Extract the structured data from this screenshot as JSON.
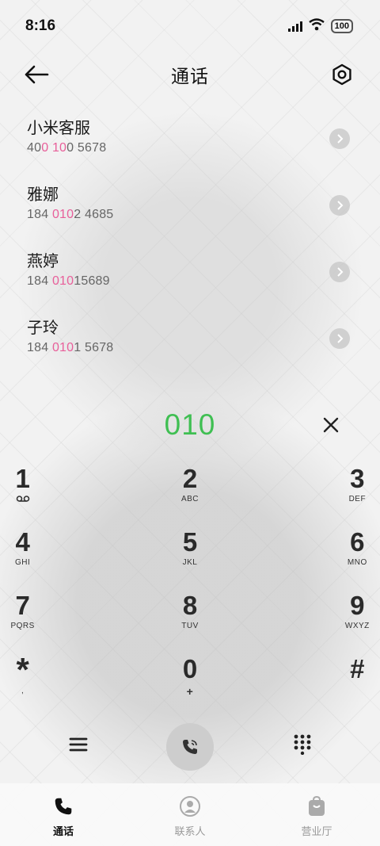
{
  "status_bar": {
    "time": "8:16",
    "battery": "100"
  },
  "header": {
    "title": "通话",
    "back_icon": "arrow-left-icon",
    "settings_icon": "gear-icon"
  },
  "contacts": [
    {
      "name": "小米客服",
      "number_parts": [
        "40",
        "0 10",
        "0 5678"
      ],
      "highlight_index": 1
    },
    {
      "name": "雅娜",
      "number_parts": [
        "184 ",
        "010",
        "2 4685"
      ],
      "highlight_index": 1
    },
    {
      "name": "燕婷",
      "number_parts": [
        "184 ",
        "010",
        "15689"
      ],
      "highlight_index": 1
    },
    {
      "name": "子玲",
      "number_parts": [
        "184 ",
        "010",
        "1 5678"
      ],
      "highlight_index": 1
    }
  ],
  "dialer": {
    "entered_number": "010",
    "number_color": "#3fbf52",
    "highlight_color": "#e85f9a"
  },
  "keypad": [
    {
      "digit": "1",
      "letters": ""
    },
    {
      "digit": "2",
      "letters": "ABC"
    },
    {
      "digit": "3",
      "letters": "DEF"
    },
    {
      "digit": "4",
      "letters": "GHI"
    },
    {
      "digit": "5",
      "letters": "JKL"
    },
    {
      "digit": "6",
      "letters": "MNO"
    },
    {
      "digit": "7",
      "letters": "PQRS"
    },
    {
      "digit": "8",
      "letters": "TUV"
    },
    {
      "digit": "9",
      "letters": "WXYZ"
    },
    {
      "digit": "*",
      "letters": ","
    },
    {
      "digit": "0",
      "letters": "+"
    },
    {
      "digit": "#",
      "letters": ""
    }
  ],
  "bottom_nav": [
    {
      "label": "通话",
      "icon": "phone-icon",
      "active": true
    },
    {
      "label": "联系人",
      "icon": "person-icon",
      "active": false
    },
    {
      "label": "营业厅",
      "icon": "shopping-bag-icon",
      "active": false
    }
  ]
}
